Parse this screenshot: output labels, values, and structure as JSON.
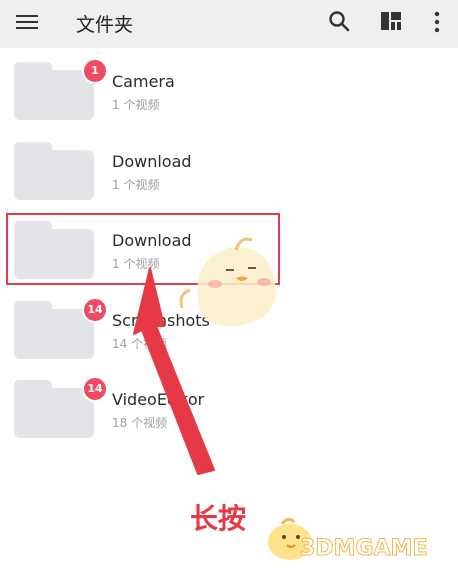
{
  "header": {
    "title": "文件夹",
    "icons": [
      "menu-icon",
      "search-icon",
      "grid-layout-icon",
      "more-vert-icon"
    ]
  },
  "folders": [
    {
      "name": "Camera",
      "count": "1 个视频",
      "badge": "1"
    },
    {
      "name": "Download",
      "count": "1 个视频",
      "badge": ""
    },
    {
      "name": "Download",
      "count": "1 个视频",
      "badge": ""
    },
    {
      "name": "Screenshots",
      "count": "14 个视频",
      "badge": "14"
    },
    {
      "name": "VideoEditor",
      "count": "18 个视频",
      "badge": "14"
    }
  ],
  "annotation": {
    "text": "长按",
    "color": "#e53946"
  },
  "watermark": {
    "text": "3DMGAME"
  },
  "colors": {
    "appbar": "#efefef",
    "badge": "#f04a63",
    "folder": "#e2e4e8",
    "highlight": "#e53946"
  }
}
